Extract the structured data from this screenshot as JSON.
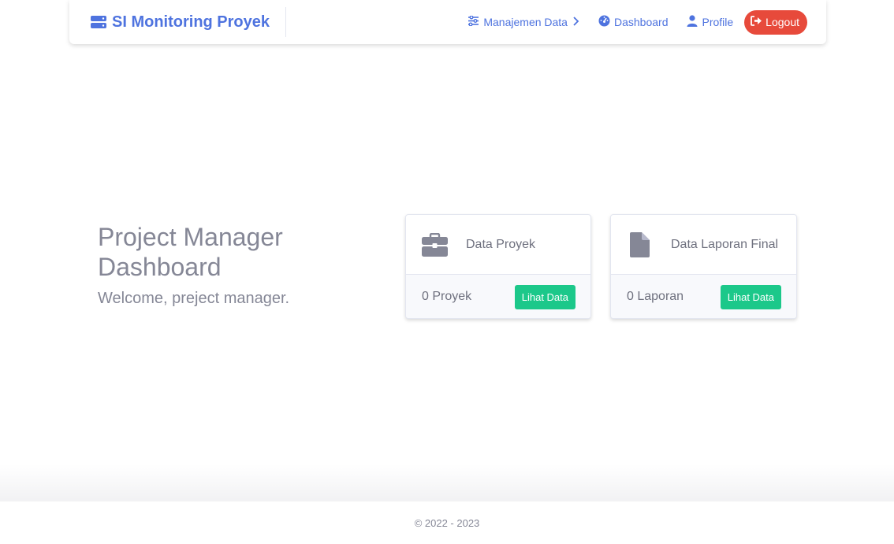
{
  "navbar": {
    "brand": "SI Monitoring Proyek",
    "brand_icon": "server-icon",
    "links": [
      {
        "label": "Manajemen Data",
        "icon": "sliders-icon"
      },
      {
        "label": "Dashboard",
        "icon": "gauge-icon"
      },
      {
        "label": "Profile",
        "icon": "user-icon"
      }
    ],
    "logout": {
      "label": "Logout",
      "icon": "sign-out-icon"
    }
  },
  "hero": {
    "title": "Project Manager Dashboard",
    "subtitle": "Welcome, preject manager."
  },
  "cards": [
    {
      "title": "Data Proyek",
      "icon": "briefcase-icon",
      "count": "0 Proyek",
      "button": "Lihat Data"
    },
    {
      "title": "Data Laporan Final",
      "icon": "file-icon",
      "count": "0 Laporan",
      "button": "Lihat Data"
    }
  ],
  "footer": {
    "copyright": "© 2022 - 2023"
  },
  "colors": {
    "primary": "#4e73df",
    "danger": "#e74a3b",
    "success": "#1cc88a",
    "muted": "#858796"
  }
}
